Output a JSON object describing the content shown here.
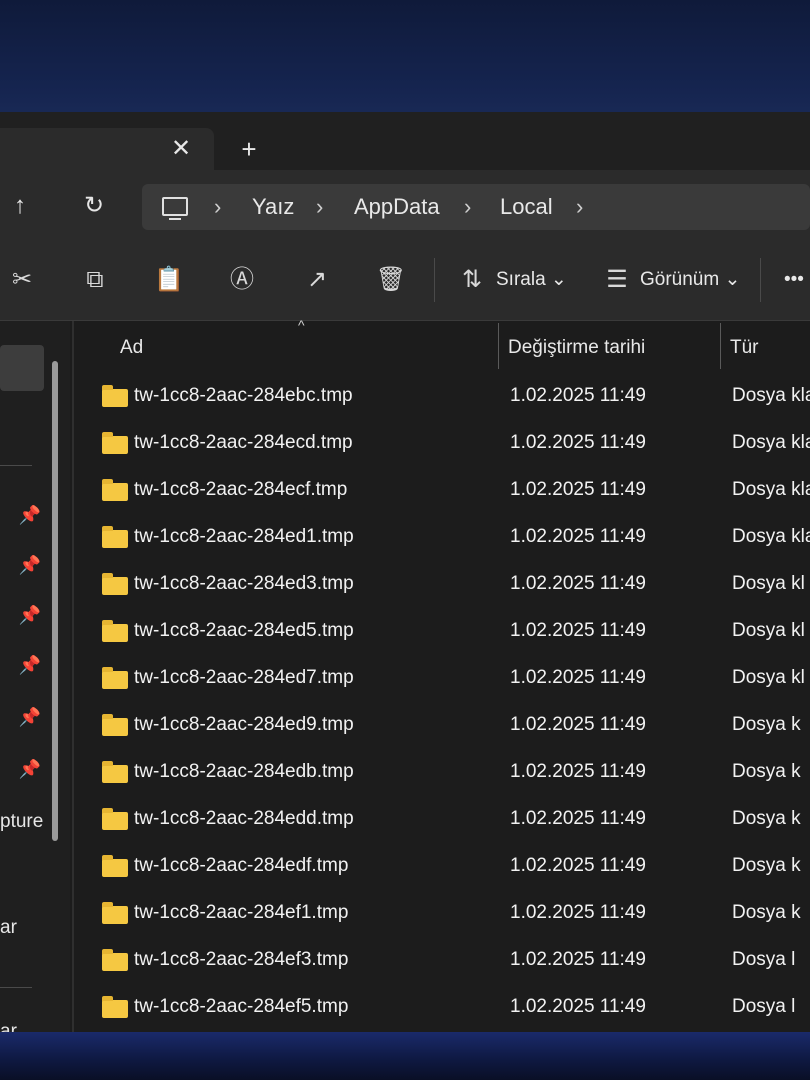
{
  "tab": {
    "close_glyph": "✕",
    "add_glyph": "+"
  },
  "nav": {
    "up_glyph": "↑",
    "refresh_glyph": "↻"
  },
  "breadcrumb": [
    "Yaız",
    "AppData",
    "Local"
  ],
  "toolbar": {
    "sort_label": "Sırala",
    "view_label": "Görünüm",
    "more_glyph": "•••"
  },
  "sidebar": {
    "texts": [
      "pture",
      "ar",
      "ar"
    ]
  },
  "columns": {
    "name": "Ad",
    "modified": "Değiştirme tarihi",
    "type": "Tür"
  },
  "files": [
    {
      "name": "tw-1cc8-2aac-284ebc.tmp",
      "modified": "1.02.2025 11:49",
      "type": "Dosya kla"
    },
    {
      "name": "tw-1cc8-2aac-284ecd.tmp",
      "modified": "1.02.2025 11:49",
      "type": "Dosya kla"
    },
    {
      "name": "tw-1cc8-2aac-284ecf.tmp",
      "modified": "1.02.2025 11:49",
      "type": "Dosya kla"
    },
    {
      "name": "tw-1cc8-2aac-284ed1.tmp",
      "modified": "1.02.2025 11:49",
      "type": "Dosya kla"
    },
    {
      "name": "tw-1cc8-2aac-284ed3.tmp",
      "modified": "1.02.2025 11:49",
      "type": "Dosya kl"
    },
    {
      "name": "tw-1cc8-2aac-284ed5.tmp",
      "modified": "1.02.2025 11:49",
      "type": "Dosya kl"
    },
    {
      "name": "tw-1cc8-2aac-284ed7.tmp",
      "modified": "1.02.2025 11:49",
      "type": "Dosya kl"
    },
    {
      "name": "tw-1cc8-2aac-284ed9.tmp",
      "modified": "1.02.2025 11:49",
      "type": "Dosya k"
    },
    {
      "name": "tw-1cc8-2aac-284edb.tmp",
      "modified": "1.02.2025 11:49",
      "type": "Dosya k"
    },
    {
      "name": "tw-1cc8-2aac-284edd.tmp",
      "modified": "1.02.2025 11:49",
      "type": "Dosya k"
    },
    {
      "name": "tw-1cc8-2aac-284edf.tmp",
      "modified": "1.02.2025 11:49",
      "type": "Dosya k"
    },
    {
      "name": "tw-1cc8-2aac-284ef1.tmp",
      "modified": "1.02.2025 11:49",
      "type": "Dosya k"
    },
    {
      "name": "tw-1cc8-2aac-284ef3.tmp",
      "modified": "1.02.2025 11:49",
      "type": "Dosya l"
    },
    {
      "name": "tw-1cc8-2aac-284ef5.tmp",
      "modified": "1.02.2025 11:49",
      "type": "Dosya l"
    }
  ]
}
